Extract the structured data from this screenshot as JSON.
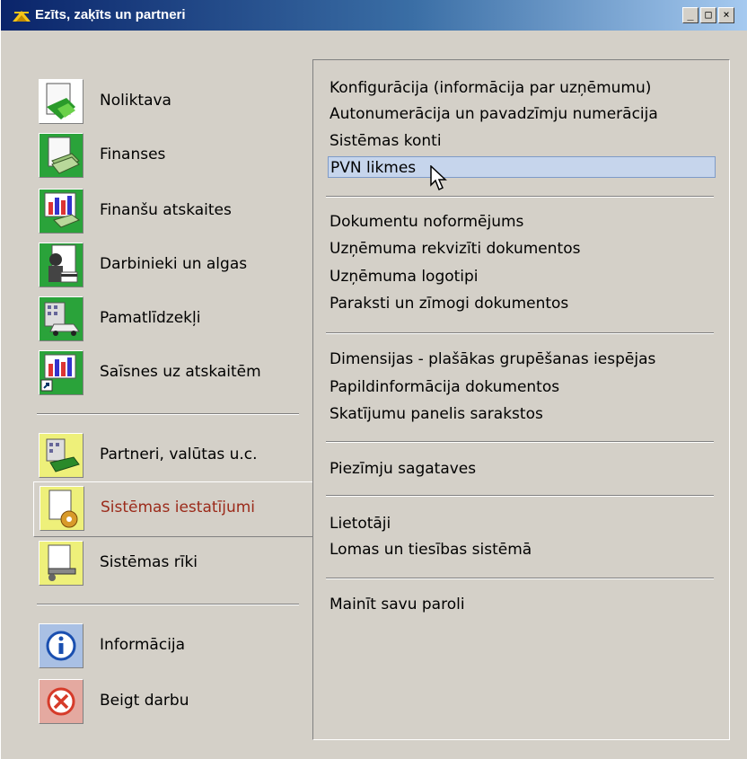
{
  "window": {
    "title": "Ezīts, zaķīts un partneri",
    "controls": {
      "minimize": "_",
      "maximize": "□",
      "close": "×"
    }
  },
  "nav": {
    "items": [
      {
        "label": "Noliktava",
        "icon": "warehouse-icon"
      },
      {
        "label": "Finanses",
        "icon": "finance-icon"
      },
      {
        "label": "Finanšu atskaites",
        "icon": "financial-reports-icon"
      },
      {
        "label": "Darbinieki un algas",
        "icon": "employees-icon"
      },
      {
        "label": "Pamatlīdzekļi",
        "icon": "fixed-assets-icon"
      },
      {
        "label": "Saīsnes uz atskaitēm",
        "icon": "report-shortcuts-icon"
      },
      {
        "label": "Partneri, valūtas u.c.",
        "icon": "partners-icon"
      },
      {
        "label": "Sistēmas iestatījumi",
        "icon": "system-settings-icon",
        "active": true
      },
      {
        "label": "Sistēmas rīki",
        "icon": "system-tools-icon"
      },
      {
        "label": "Informācija",
        "icon": "info-icon"
      },
      {
        "label": "Beigt darbu",
        "icon": "exit-icon"
      }
    ]
  },
  "menu": {
    "groups": [
      [
        "Konfigurācija (informācija par uzņēmumu)",
        "Autonumerācija un pavadzīmju numerācija",
        "Sistēmas konti",
        "PVN likmes"
      ],
      [
        "Dokumentu noformējums",
        "Uzņēmuma rekvizīti dokumentos",
        "Uzņēmuma logotipi",
        "Paraksti un zīmogi dokumentos"
      ],
      [
        "Dimensijas - plašākas grupēšanas iespējas",
        "Papildinformācija dokumentos",
        "Skatījumu panelis sarakstos"
      ],
      [
        "Piezīmju sagataves"
      ],
      [
        "Lietotāji",
        "Lomas un tiesības sistēmā"
      ],
      [
        "Mainīt savu paroli"
      ]
    ],
    "highlighted": "PVN likmes"
  },
  "colors": {
    "titlebar_start": "#0a246a",
    "active_label": "#9b2a1a",
    "highlight": "#c6d5ec"
  }
}
